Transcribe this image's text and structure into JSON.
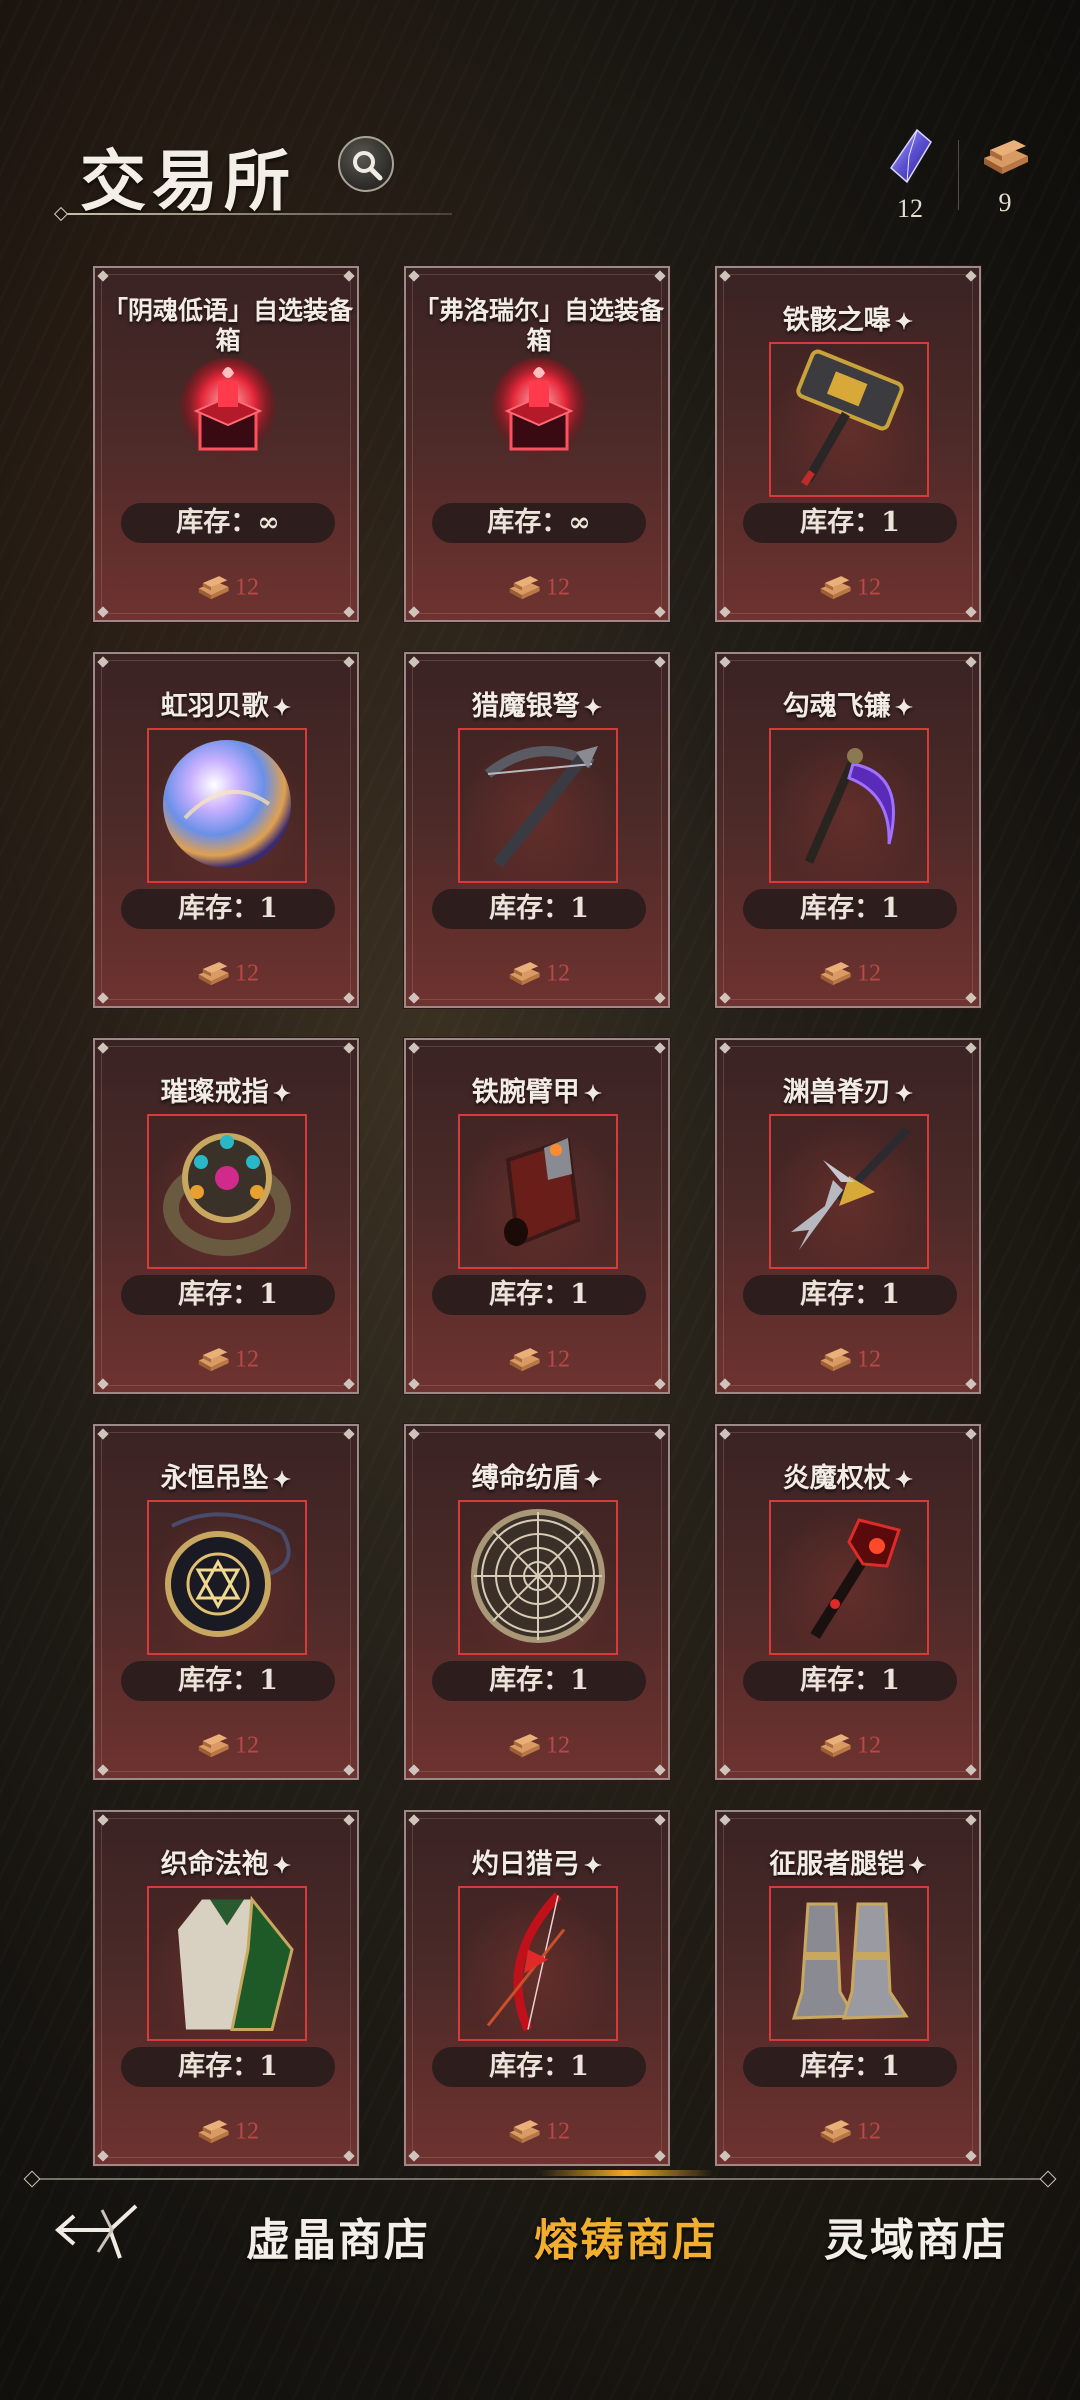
{
  "header": {
    "title": "交易所",
    "currencies": [
      {
        "icon": "crystal-icon",
        "amount": "12"
      },
      {
        "icon": "ingot-icon",
        "amount": "9"
      }
    ]
  },
  "stock_label": "库存：",
  "items": [
    {
      "name": "「阴魂低语」自选装备箱",
      "stock": "∞",
      "price": "12",
      "icon": "chest-icon",
      "featured": false
    },
    {
      "name": "「弗洛瑞尔」自选装备箱",
      "stock": "∞",
      "price": "12",
      "icon": "chest-icon",
      "featured": false
    },
    {
      "name": "铁骸之嗥",
      "stock": "1",
      "price": "12",
      "icon": "hammer-icon",
      "featured": true
    },
    {
      "name": "虹羽贝歌",
      "stock": "1",
      "price": "12",
      "icon": "orb-icon",
      "featured": true
    },
    {
      "name": "猎魔银弩",
      "stock": "1",
      "price": "12",
      "icon": "crossbow-icon",
      "featured": true
    },
    {
      "name": "勾魂飞镰",
      "stock": "1",
      "price": "12",
      "icon": "scythe-icon",
      "featured": true
    },
    {
      "name": "璀璨戒指",
      "stock": "1",
      "price": "12",
      "icon": "ring-icon",
      "featured": true
    },
    {
      "name": "铁腕臂甲",
      "stock": "1",
      "price": "12",
      "icon": "bracer-icon",
      "featured": true
    },
    {
      "name": "渊兽脊刃",
      "stock": "1",
      "price": "12",
      "icon": "blade-icon",
      "featured": true
    },
    {
      "name": "永恒吊坠",
      "stock": "1",
      "price": "12",
      "icon": "pendant-icon",
      "featured": true
    },
    {
      "name": "缚命纺盾",
      "stock": "1",
      "price": "12",
      "icon": "shield-icon",
      "featured": true
    },
    {
      "name": "炎魔权杖",
      "stock": "1",
      "price": "12",
      "icon": "scepter-icon",
      "featured": true
    },
    {
      "name": "织命法袍",
      "stock": "1",
      "price": "12",
      "icon": "robe-icon",
      "featured": true
    },
    {
      "name": "灼日猎弓",
      "stock": "1",
      "price": "12",
      "icon": "bow-icon",
      "featured": true
    },
    {
      "name": "征服者腿铠",
      "stock": "1",
      "price": "12",
      "icon": "greaves-icon",
      "featured": true
    }
  ],
  "nav": {
    "tabs": [
      {
        "label": "虚晶商店",
        "active": false
      },
      {
        "label": "熔铸商店",
        "active": true
      },
      {
        "label": "灵域商店",
        "active": false
      }
    ],
    "active_color": "#f2ae2d"
  }
}
